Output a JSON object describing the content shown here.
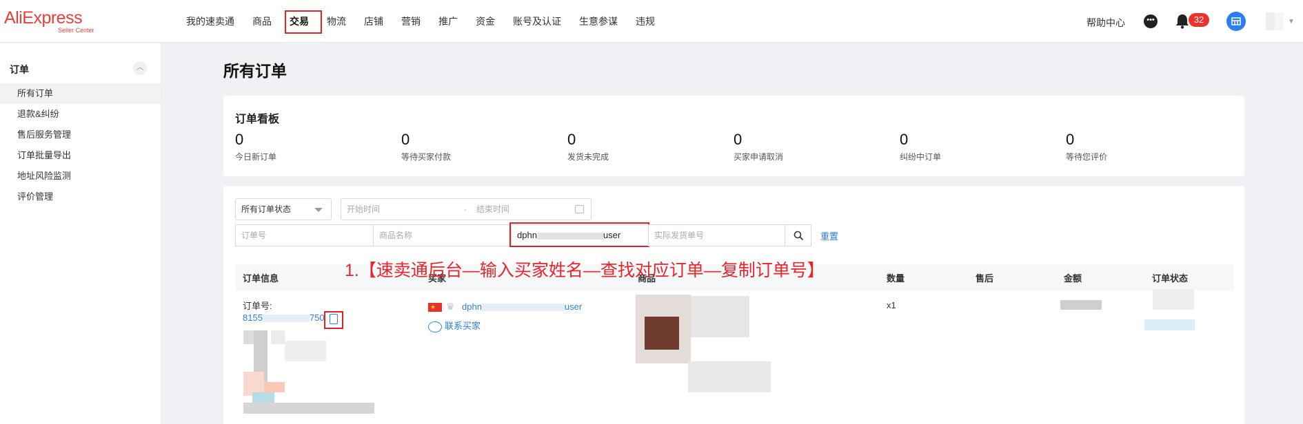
{
  "app": {
    "logo_main": "AliExpress",
    "logo_sub": "Seller Center"
  },
  "nav": {
    "items": [
      "我的速卖通",
      "商品",
      "交易",
      "物流",
      "店铺",
      "营销",
      "推广",
      "资金",
      "账号及认证",
      "生意参谋",
      "违规"
    ],
    "active": "交易"
  },
  "header": {
    "help": "帮助中心",
    "notification_count": "32"
  },
  "sidebar": {
    "section": "订单",
    "items": [
      {
        "label": "所有订单",
        "active": true
      },
      {
        "label": "退款&纠纷",
        "active": false
      },
      {
        "label": "售后服务管理",
        "active": false
      },
      {
        "label": "订单批量导出",
        "active": false
      },
      {
        "label": "地址风险监测",
        "active": false
      },
      {
        "label": "评价管理",
        "active": false
      }
    ]
  },
  "main": {
    "title": "所有订单",
    "board": {
      "title": "订单看板",
      "stats": [
        {
          "value": "0",
          "label": "今日新订单"
        },
        {
          "value": "0",
          "label": "等待买家付款"
        },
        {
          "value": "0",
          "label": "发货未完成"
        },
        {
          "value": "0",
          "label": "买家申请取消"
        },
        {
          "value": "0",
          "label": "纠纷中订单"
        },
        {
          "value": "0",
          "label": "等待您评价"
        }
      ]
    },
    "filters": {
      "status_select": "所有订单状态",
      "start_placeholder": "开始时间",
      "end_placeholder": "结束时间",
      "date_separator": "-",
      "order_no_placeholder": "订单号",
      "product_placeholder": "商品名称",
      "buyer_value_prefix": "dphn",
      "buyer_value_suffix": "user",
      "tracking_placeholder": "实际发货单号",
      "reset": "重置"
    },
    "annotation": "1.【速卖通后台—输入买家姓名—查找对应订单—复制订单号】",
    "table": {
      "headers": [
        "订单信息",
        "买家",
        "商品",
        "数量",
        "售后",
        "金额",
        "订单状态"
      ],
      "row": {
        "order_label": "订单号:",
        "order_no_prefix": "8155",
        "order_no_suffix": "750",
        "buyer_prefix": "dphn",
        "buyer_suffix": "user",
        "contact": "联系买家",
        "quantity": "x1"
      }
    }
  },
  "colors": {
    "brand": "#e8403a",
    "link": "#2a7df2",
    "highlight": "#d9232b",
    "badge": "#f0302c"
  }
}
